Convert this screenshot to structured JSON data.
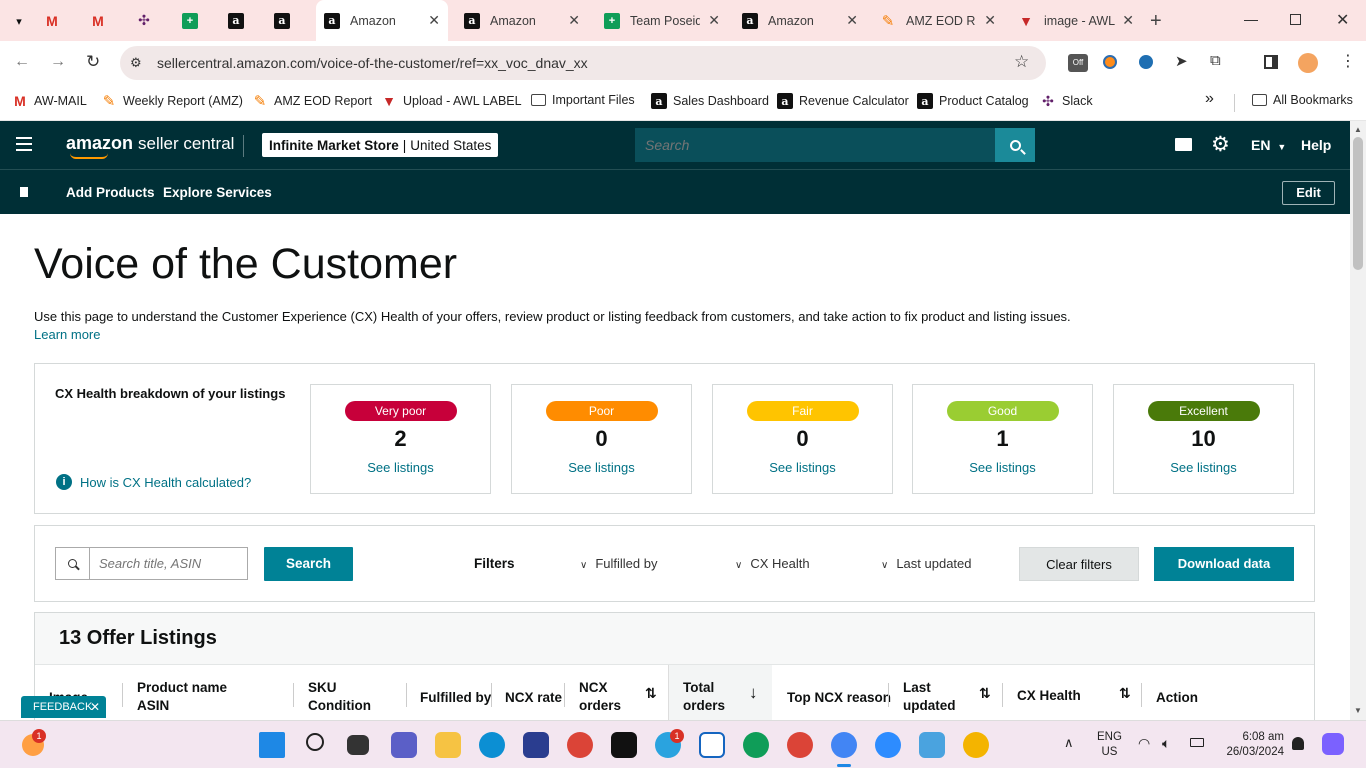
{
  "tabs": [
    {
      "title": "",
      "icon": "gmail-icon"
    },
    {
      "title": "",
      "icon": "gmail-icon"
    },
    {
      "title": "",
      "icon": "slack-icon"
    },
    {
      "title": "",
      "icon": "sheets-icon"
    },
    {
      "title": "",
      "icon": "amazon-icon"
    },
    {
      "title": "",
      "icon": "amazon-icon"
    },
    {
      "title": "Amazon",
      "icon": "amazon-icon"
    },
    {
      "title": "Amazon",
      "icon": "amazon-icon"
    },
    {
      "title": "Team Poseid",
      "icon": "sheets-icon"
    },
    {
      "title": "Amazon",
      "icon": "amazon-icon"
    },
    {
      "title": "AMZ EOD Re",
      "icon": "amz-eod-icon"
    },
    {
      "title": "image - AWL",
      "icon": "image-icon"
    }
  ],
  "address": {
    "url": "sellercentral.amazon.com/voice-of-the-customer/ref=xx_voc_dnav_xx"
  },
  "bookmarks": [
    {
      "label": "AW-MAIL"
    },
    {
      "label": "Weekly Report (AMZ)"
    },
    {
      "label": "AMZ EOD Report"
    },
    {
      "label": "Upload - AWL LABEL"
    },
    {
      "label": "Important Files"
    },
    {
      "label": "Sales Dashboard"
    },
    {
      "label": "Revenue Calculator"
    },
    {
      "label": "Product Catalog"
    },
    {
      "label": "Slack"
    }
  ],
  "all_bookmarks": "All Bookmarks",
  "overflow": "»",
  "seller_nav": {
    "logo_main": "amazon",
    "logo_sub": "seller central",
    "store_name": "Infinite Market Store",
    "store_region": "United States",
    "search_placeholder": "Search",
    "lang": "EN",
    "help": "Help",
    "sub_items": [
      "Add Products",
      "Explore Services"
    ],
    "edit": "Edit"
  },
  "page": {
    "title": "Voice of the Customer",
    "description": "Use this page to understand the Customer Experience (CX) Health of your offers, review product or listing feedback from customers, and take action to fix product and listing issues.",
    "learn_more": "Learn more",
    "breakdown_title": "CX Health breakdown of your listings",
    "how_calculated": "How is CX Health calculated?",
    "cx_cards": [
      {
        "label": "Very poor",
        "count": "2",
        "link": "See listings",
        "color": "#c7003a",
        "text_color": "#ffffff"
      },
      {
        "label": "Poor",
        "count": "0",
        "link": "See listings",
        "color": "#ff8c00",
        "text_color": "#ffffff"
      },
      {
        "label": "Fair",
        "count": "0",
        "link": "See listings",
        "color": "#ffc400",
        "text_color": "#ffffff"
      },
      {
        "label": "Good",
        "count": "1",
        "link": "See listings",
        "color": "#9acd32",
        "text_color": "#ffffff"
      },
      {
        "label": "Excellent",
        "count": "10",
        "link": "See listings",
        "color": "#4a7a0a",
        "text_color": "#ffffff"
      }
    ],
    "search_placeholder": "Search title, ASIN",
    "search_button": "Search",
    "filters_label": "Filters",
    "filter_fulfilled": "Fulfilled by",
    "filter_cx": "CX Health",
    "filter_updated": "Last updated",
    "clear_filters": "Clear filters",
    "download": "Download data",
    "listings_title": "13 Offer Listings",
    "columns": [
      {
        "line1": "Image",
        "line2": ""
      },
      {
        "line1": "Product name",
        "line2": "ASIN"
      },
      {
        "line1": "SKU",
        "line2": "Condition"
      },
      {
        "line1": "Fulfilled by",
        "line2": ""
      },
      {
        "line1": "NCX rate",
        "line2": ""
      },
      {
        "line1": "NCX",
        "line2": "orders"
      },
      {
        "line1": "Total",
        "line2": "orders"
      },
      {
        "line1": "Top NCX reason",
        "line2": ""
      },
      {
        "line1": "Last",
        "line2": "updated"
      },
      {
        "line1": "CX Health",
        "line2": ""
      },
      {
        "line1": "Action",
        "line2": ""
      }
    ],
    "feedback": "FEEDBACK"
  },
  "taskbar": {
    "weather_badge": "1",
    "telegram_badge": "1",
    "lang_line1": "ENG",
    "lang_line2": "US",
    "time": "6:08 am",
    "date": "26/03/2024"
  },
  "colors": {
    "nav_bg": "#002f36",
    "accent_teal": "#008296",
    "link": "#007185"
  }
}
